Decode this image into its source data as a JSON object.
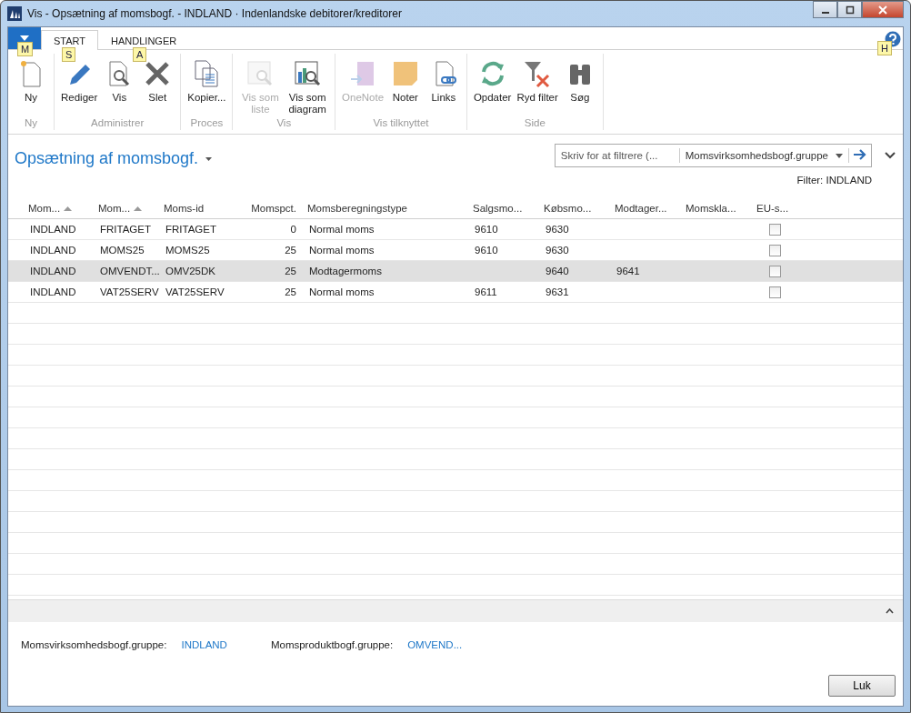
{
  "window": {
    "title": "Vis - Opsætning af momsbogf. - INDLAND · Indenlandske debitorer/kreditorer"
  },
  "tabs": [
    {
      "label": "START",
      "selected": true
    },
    {
      "label": "HANDLINGER",
      "selected": false
    }
  ],
  "key_tips": [
    {
      "label": "M",
      "kind": "app"
    },
    {
      "label": "S",
      "kind": "start"
    },
    {
      "label": "A",
      "kind": "actions"
    },
    {
      "label": "H",
      "kind": "help"
    }
  ],
  "ribbon": [
    {
      "group": "Ny",
      "items": [
        {
          "label": "Ny",
          "kind": "new",
          "disabled": false
        }
      ]
    },
    {
      "group": "Administrer",
      "items": [
        {
          "label": "Rediger",
          "kind": "edit",
          "disabled": false
        },
        {
          "label": "Vis",
          "kind": "view",
          "disabled": false
        },
        {
          "label": "Slet",
          "kind": "delete",
          "disabled": false
        }
      ]
    },
    {
      "group": "Proces",
      "items": [
        {
          "label": "Kopier...",
          "kind": "copy",
          "disabled": false
        }
      ]
    },
    {
      "group": "Vis",
      "items": [
        {
          "label": "Vis som liste",
          "kind": "list",
          "disabled": true
        },
        {
          "label": "Vis som diagram",
          "kind": "chart",
          "disabled": false
        }
      ]
    },
    {
      "group": "Vis tilknyttet",
      "items": [
        {
          "label": "OneNote",
          "kind": "onenote",
          "disabled": true
        },
        {
          "label": "Noter",
          "kind": "note",
          "disabled": false
        },
        {
          "label": "Links",
          "kind": "link",
          "disabled": false
        }
      ]
    },
    {
      "group": "Side",
      "items": [
        {
          "label": "Opdater",
          "kind": "refresh",
          "disabled": false
        },
        {
          "label": "Ryd filter",
          "kind": "clearfilter",
          "disabled": false
        },
        {
          "label": "Søg",
          "kind": "find",
          "disabled": false
        }
      ]
    }
  ],
  "page_title": "Opsætning af momsbogf.",
  "filter": {
    "placeholder": "Skriv for at filtrere (...",
    "field": "Momsvirksomhedsbogf.gruppe",
    "applied": "Filter: INDLAND"
  },
  "table": {
    "columns": [
      {
        "label": "Mom...",
        "sorted": true,
        "kind": "text"
      },
      {
        "label": "Mom...",
        "sorted": true,
        "kind": "text"
      },
      {
        "label": "Moms-id",
        "sorted": false,
        "kind": "text"
      },
      {
        "label": "Momspct.",
        "sorted": false,
        "kind": "number"
      },
      {
        "label": "Momsberegningstype",
        "sorted": false,
        "kind": "text"
      },
      {
        "label": "Salgsmo...",
        "sorted": false,
        "kind": "text"
      },
      {
        "label": "Købsmo...",
        "sorted": false,
        "kind": "text"
      },
      {
        "label": "Modtager...",
        "sorted": false,
        "kind": "text"
      },
      {
        "label": "Momskla...",
        "sorted": false,
        "kind": "text"
      },
      {
        "label": "EU-s...",
        "sorted": false,
        "kind": "text"
      }
    ],
    "rows": [
      {
        "selected": false,
        "cells": [
          "INDLAND",
          "FRITAGET",
          "FRITAGET",
          "0",
          "Normal moms",
          "9610",
          "9630",
          "",
          ""
        ],
        "eu_checked": false
      },
      {
        "selected": false,
        "cells": [
          "INDLAND",
          "MOMS25",
          "MOMS25",
          "25",
          "Normal moms",
          "9610",
          "9630",
          "",
          ""
        ],
        "eu_checked": false
      },
      {
        "selected": true,
        "cells": [
          "INDLAND",
          "OMVENDT...",
          "OMV25DK",
          "25",
          "Modtagermoms",
          "",
          "9640",
          "9641",
          ""
        ],
        "eu_checked": false
      },
      {
        "selected": false,
        "cells": [
          "INDLAND",
          "VAT25SERV",
          "VAT25SERV",
          "25",
          "Normal moms",
          "9611",
          "9631",
          "",
          ""
        ],
        "eu_checked": false
      }
    ]
  },
  "details": [
    {
      "label": "Momsvirksomhedsbogf.gruppe:",
      "value": "INDLAND"
    },
    {
      "label": "Momsproduktbogf.gruppe:",
      "value": "OMVEND..."
    }
  ],
  "buttons": [
    "Luk"
  ]
}
